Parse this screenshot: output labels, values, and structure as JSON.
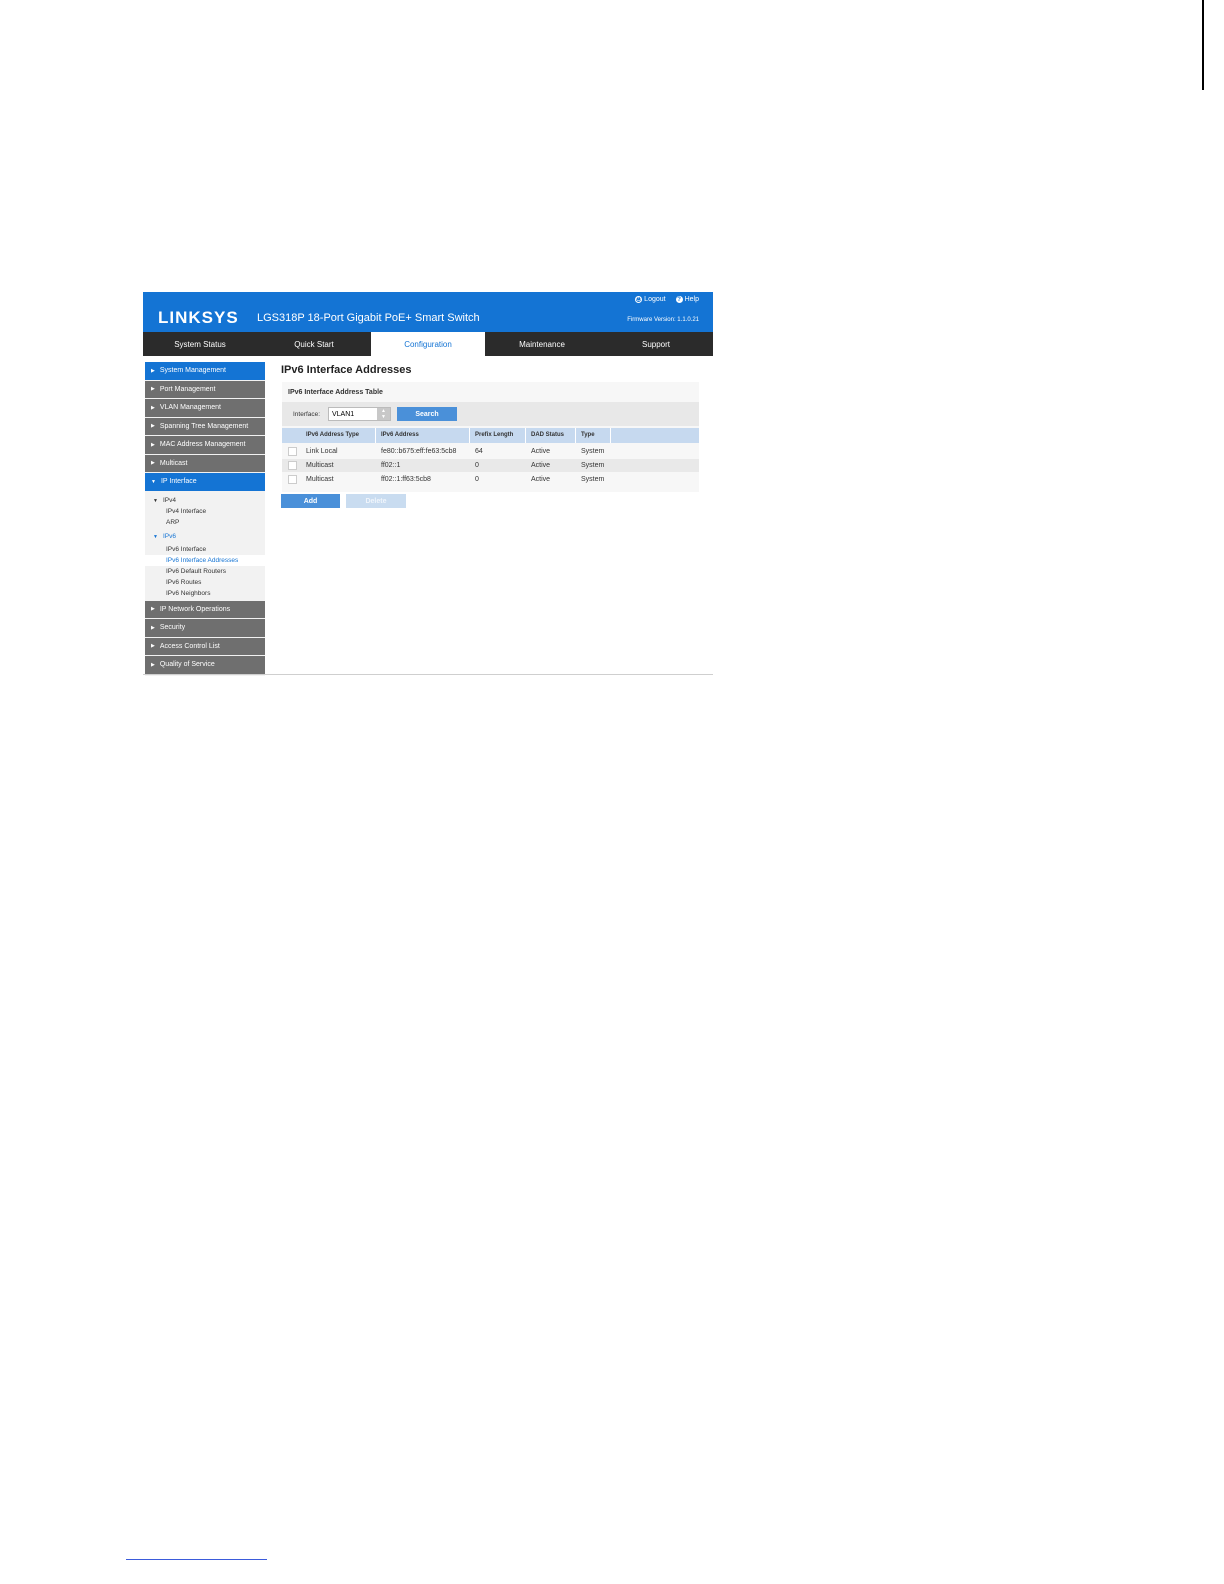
{
  "header": {
    "logo": "LINKSYS",
    "product": "LGS318P 18-Port Gigabit PoE+ Smart Switch",
    "logout_label": "Logout",
    "help_label": "Help",
    "firmware": "Firmware Version: 1.1.0.21",
    "brand_color": "#1474d4"
  },
  "nav": {
    "tabs": [
      {
        "label": "System Status"
      },
      {
        "label": "Quick Start"
      },
      {
        "label": "Configuration"
      },
      {
        "label": "Maintenance"
      },
      {
        "label": "Support"
      }
    ],
    "active": "Configuration"
  },
  "sidebar": {
    "sections_top": [
      {
        "label": "System Management"
      },
      {
        "label": "Port Management"
      },
      {
        "label": "VLAN Management"
      },
      {
        "label": "Spanning Tree Management"
      },
      {
        "label": "MAC Address Management"
      },
      {
        "label": "Multicast"
      }
    ],
    "ip_interface": {
      "label": "IP Interface",
      "ipv4": {
        "label": "IPv4",
        "items": [
          {
            "label": "IPv4 Interface"
          },
          {
            "label": "ARP"
          }
        ]
      },
      "ipv6": {
        "label": "IPv6",
        "items": [
          {
            "label": "IPv6 Interface"
          },
          {
            "label": "IPv6 Interface Addresses"
          },
          {
            "label": "IPv6 Default Routers"
          },
          {
            "label": "IPv6 Routes"
          },
          {
            "label": "IPv6 Neighbors"
          }
        ]
      }
    },
    "sections_bottom": [
      {
        "label": "IP Network Operations"
      },
      {
        "label": "Security"
      },
      {
        "label": "Access Control List"
      },
      {
        "label": "Quality of Service"
      }
    ]
  },
  "main": {
    "title": "IPv6 Interface Addresses",
    "table_title": "IPv6 Interface Address Table",
    "filter_label": "Interface:",
    "interface_value": "VLAN1",
    "search_label": "Search",
    "columns": [
      "IPv6 Address Type",
      "IPv6 Address",
      "Prefix Length",
      "DAD Status",
      "Type"
    ],
    "rows": [
      [
        "Link Local",
        "fe80::b675:eff:fe63:5cb8",
        "64",
        "Active",
        "System"
      ],
      [
        "Multicast",
        "ff02::1",
        "0",
        "Active",
        "System"
      ],
      [
        "Multicast",
        "ff02::1:ff63:5cb8",
        "0",
        "Active",
        "System"
      ]
    ],
    "add_label": "Add",
    "delete_label": "Delete"
  }
}
